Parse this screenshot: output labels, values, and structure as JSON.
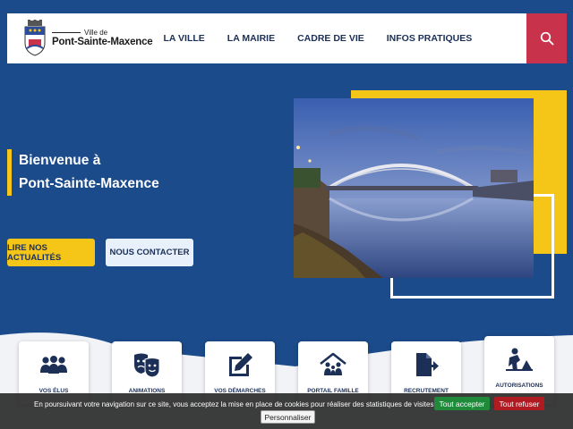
{
  "header": {
    "logo_small": "Ville de",
    "logo_big": "Pont-Sainte-Maxence",
    "nav": [
      "LA VILLE",
      "LA MAIRIE",
      "CADRE DE VIE",
      "INFOS PRATIQUES"
    ],
    "search_icon": "search-icon"
  },
  "hero": {
    "welcome_line1": "Bienvenue à",
    "welcome_line2": "Pont-Sainte-Maxence",
    "news_button": "LIRE NOS ACTUALITÉS",
    "contact_button": "NOUS CONTACTER",
    "photo_icon": "bridge-photo"
  },
  "tiles": [
    {
      "label": "VOS ÉLUS",
      "icon": "people-icon"
    },
    {
      "label": "ANIMATIONS",
      "icon": "theater-masks-icon"
    },
    {
      "label": "VOS DÉMARCHES",
      "icon": "edit-icon"
    },
    {
      "label": "PORTAIL FAMILLE",
      "icon": "family-house-icon"
    },
    {
      "label": "RECRUTEMENT",
      "icon": "file-export-icon"
    },
    {
      "label": "AUTORISATIONS",
      "icon": "construction-worker-icon"
    }
  ],
  "cookie": {
    "text": "En poursuivant votre navigation sur ce site, vous acceptez la mise en place de cookies pour réaliser des statistiques de visites.",
    "accept": "Tout accepter",
    "refuse": "Tout refuser",
    "customize": "Personnaliser"
  },
  "colors": {
    "background": "#1b4b8a",
    "accent_yellow": "#f5c518",
    "search_red": "#c8324a",
    "nav_text": "#1b2f57"
  }
}
